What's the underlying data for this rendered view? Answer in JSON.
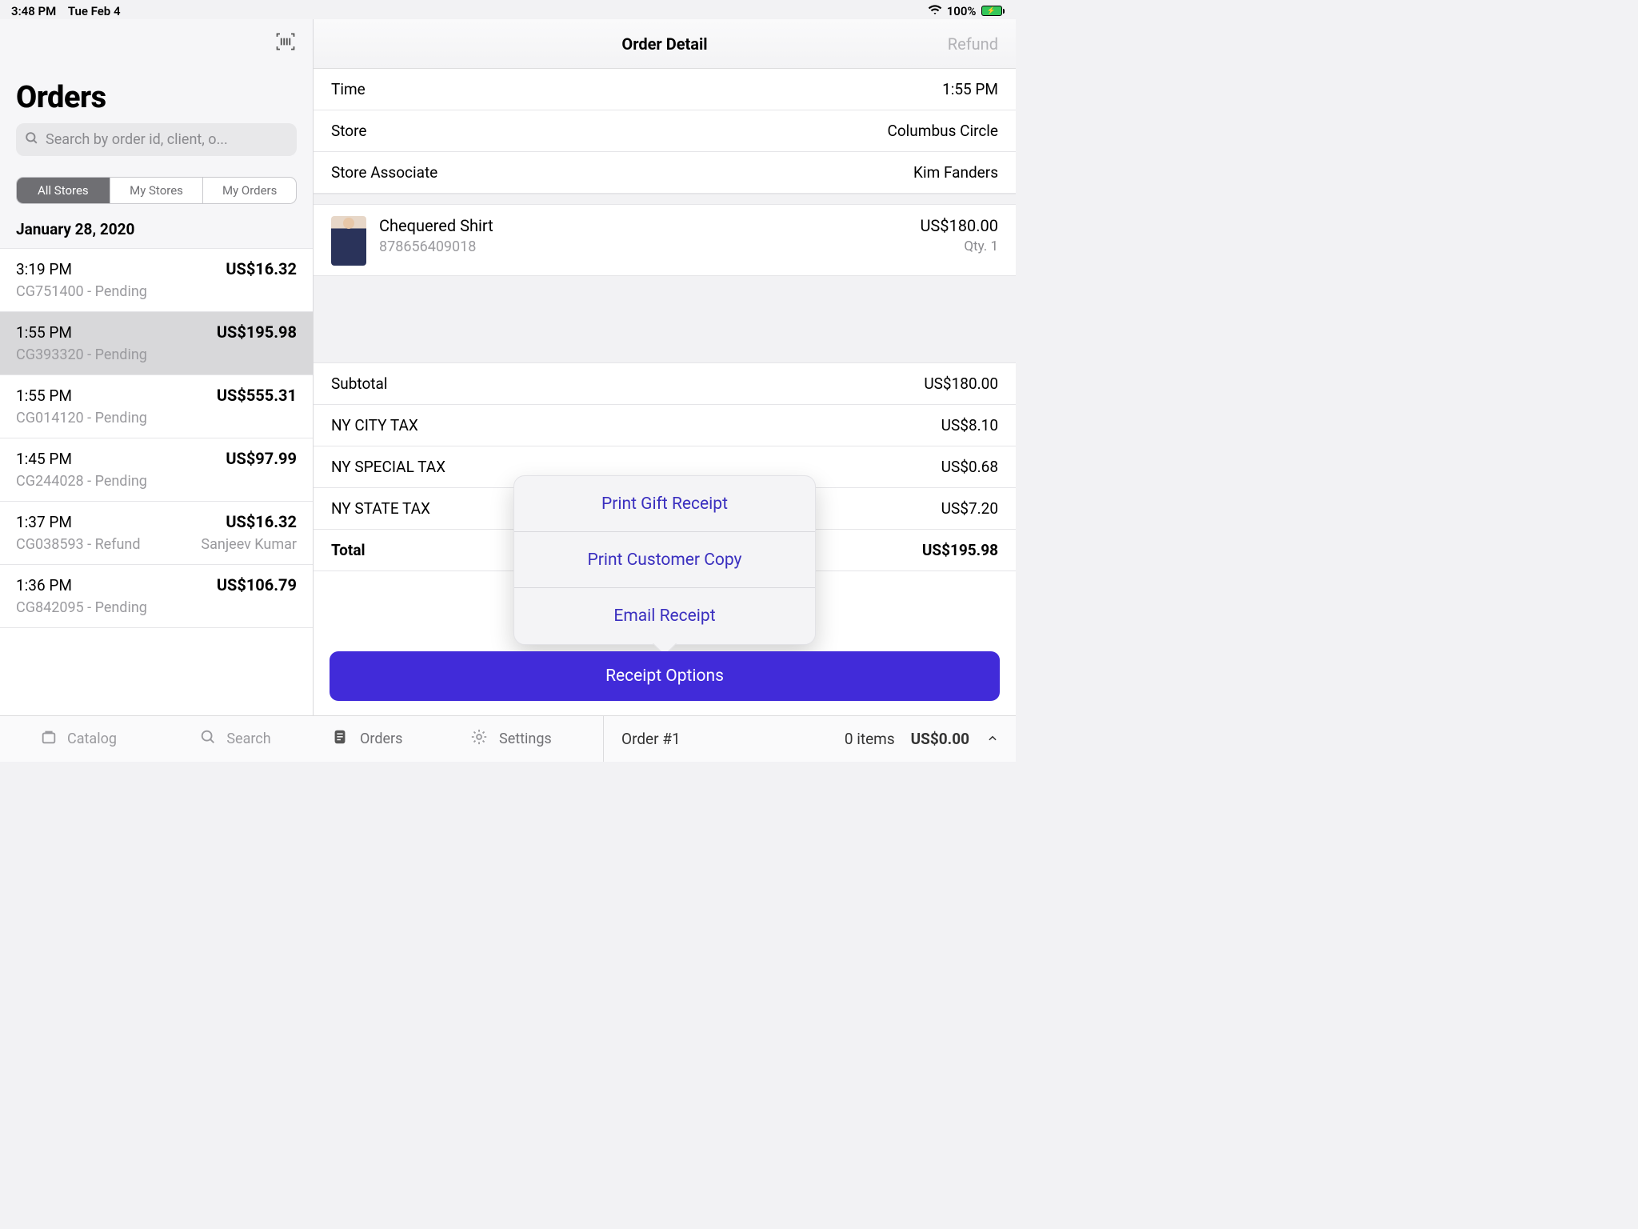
{
  "statusbar": {
    "time": "3:48 PM",
    "date": "Tue Feb 4",
    "battery_pct": "100%"
  },
  "left": {
    "title": "Orders",
    "search_placeholder": "Search by order id, client, o...",
    "segments": {
      "all": "All Stores",
      "mine": "My Stores",
      "my_orders": "My Orders"
    },
    "date_header": "January 28, 2020",
    "items": [
      {
        "time": "3:19 PM",
        "amount": "US$16.32",
        "meta": "CG751400 - Pending",
        "client": ""
      },
      {
        "time": "1:55 PM",
        "amount": "US$195.98",
        "meta": "CG393320 - Pending",
        "client": ""
      },
      {
        "time": "1:55 PM",
        "amount": "US$555.31",
        "meta": "CG014120 - Pending",
        "client": ""
      },
      {
        "time": "1:45 PM",
        "amount": "US$97.99",
        "meta": "CG244028 - Pending",
        "client": ""
      },
      {
        "time": "1:37 PM",
        "amount": "US$16.32",
        "meta": "CG038593 - Refund",
        "client": "Sanjeev Kumar"
      },
      {
        "time": "1:36 PM",
        "amount": "US$106.79",
        "meta": "CG842095 - Pending",
        "client": ""
      }
    ]
  },
  "detail": {
    "title": "Order Detail",
    "refund_label": "Refund",
    "info": {
      "time_label": "Time",
      "time_value": "1:55 PM",
      "store_label": "Store",
      "store_value": "Columbus Circle",
      "assoc_label": "Store Associate",
      "assoc_value": "Kim Fanders"
    },
    "item": {
      "name": "Chequered Shirt",
      "sku": "878656409018",
      "price": "US$180.00",
      "qty": "Qty. 1"
    },
    "totals": {
      "subtotal_label": "Subtotal",
      "subtotal_value": "US$180.00",
      "city_label": "NY CITY TAX",
      "city_value": "US$8.10",
      "special_label": "NY SPECIAL TAX",
      "special_value": "US$0.68",
      "state_label": "NY STATE TAX",
      "state_value": "US$7.20",
      "total_label": "Total",
      "total_value": "US$195.98"
    },
    "receipt_button": "Receipt Options",
    "popover": {
      "gift": "Print Gift Receipt",
      "cust": "Print Customer Copy",
      "email": "Email Receipt"
    }
  },
  "bottom": {
    "catalog": "Catalog",
    "search": "Search",
    "orders": "Orders",
    "settings": "Settings",
    "order_num": "Order #1",
    "cart_items": "0 items",
    "cart_total": "US$0.00"
  },
  "colors": {
    "primary": "#412bd9",
    "link": "#3a2fbf"
  }
}
